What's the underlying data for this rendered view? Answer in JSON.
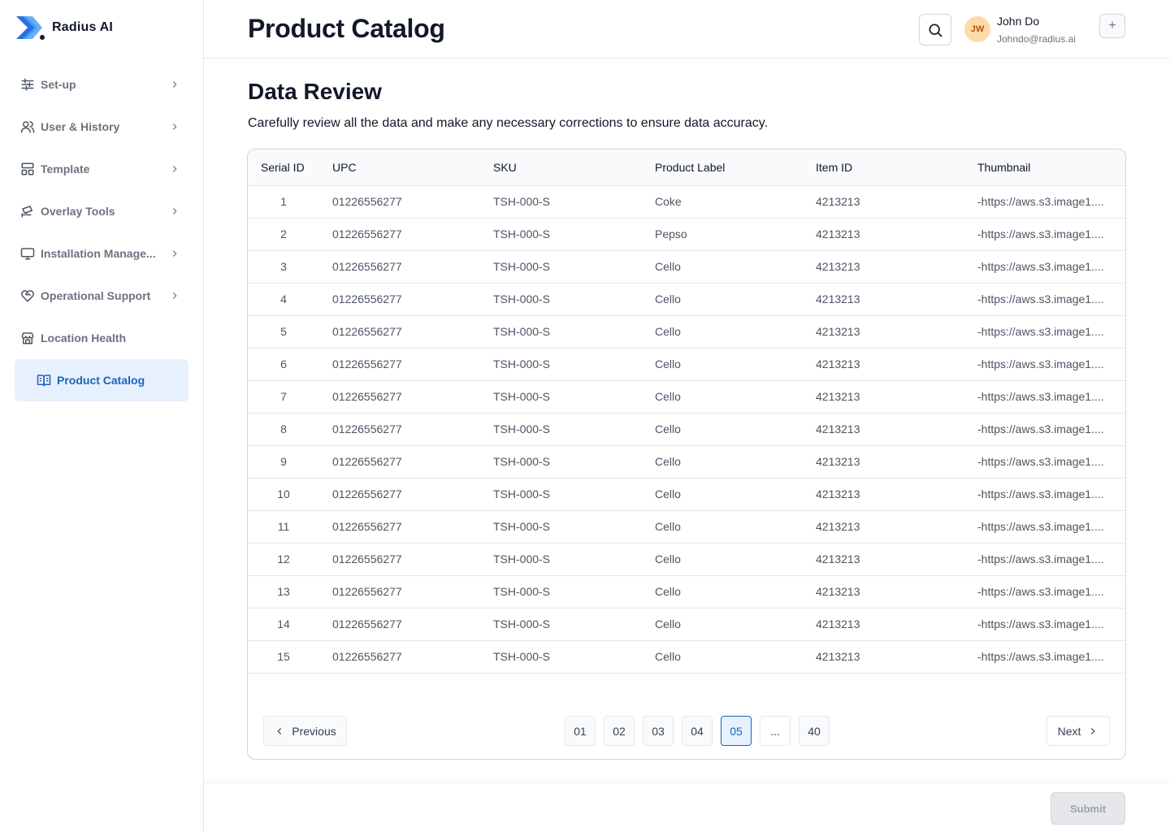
{
  "brand": {
    "name": "Radius AI",
    "logo_icon": "radius-logo"
  },
  "sidebar": {
    "items": [
      {
        "label": "Set-up",
        "icon": "sliders-icon",
        "has_chevron": true
      },
      {
        "label": "User & History",
        "icon": "users-icon",
        "has_chevron": true
      },
      {
        "label": "Template",
        "icon": "layout-icon",
        "has_chevron": true
      },
      {
        "label": "Overlay Tools",
        "icon": "cctv-icon",
        "has_chevron": true
      },
      {
        "label": "Installation Manage...",
        "icon": "monitor-icon",
        "has_chevron": true
      },
      {
        "label": "Operational Support",
        "icon": "heart-handshake-icon",
        "has_chevron": true
      },
      {
        "label": "Location Health",
        "icon": "store-icon",
        "has_chevron": false
      },
      {
        "label": "Product Catalog",
        "icon": "book-open-icon",
        "has_chevron": false,
        "active": true
      }
    ]
  },
  "header": {
    "title": "Product Catalog",
    "user": {
      "initials": "JW",
      "name": "John Do",
      "email": "Johndo@radius.ai"
    },
    "plus_label": "+"
  },
  "section": {
    "title": "Data Review",
    "description": "Carefully review all the data and make any necessary corrections to ensure data accuracy."
  },
  "table": {
    "columns": [
      "Serial ID",
      "UPC",
      "SKU",
      "Product Label",
      "Item ID",
      "Thumbnail"
    ],
    "rows": [
      [
        "1",
        "01226556277",
        "TSH-000-S",
        "Coke",
        "4213213",
        "-https://aws.s3.image1...."
      ],
      [
        "2",
        "01226556277",
        "TSH-000-S",
        "Pepso",
        "4213213",
        "-https://aws.s3.image1...."
      ],
      [
        "3",
        "01226556277",
        "TSH-000-S",
        "Cello",
        "4213213",
        "-https://aws.s3.image1...."
      ],
      [
        "4",
        "01226556277",
        "TSH-000-S",
        "Cello",
        "4213213",
        "-https://aws.s3.image1...."
      ],
      [
        "5",
        "01226556277",
        "TSH-000-S",
        "Cello",
        "4213213",
        "-https://aws.s3.image1...."
      ],
      [
        "6",
        "01226556277",
        "TSH-000-S",
        "Cello",
        "4213213",
        "-https://aws.s3.image1...."
      ],
      [
        "7",
        "01226556277",
        "TSH-000-S",
        "Cello",
        "4213213",
        "-https://aws.s3.image1...."
      ],
      [
        "8",
        "01226556277",
        "TSH-000-S",
        "Cello",
        "4213213",
        "-https://aws.s3.image1...."
      ],
      [
        "9",
        "01226556277",
        "TSH-000-S",
        "Cello",
        "4213213",
        "-https://aws.s3.image1...."
      ],
      [
        "10",
        "01226556277",
        "TSH-000-S",
        "Cello",
        "4213213",
        "-https://aws.s3.image1...."
      ],
      [
        "11",
        "01226556277",
        "TSH-000-S",
        "Cello",
        "4213213",
        "-https://aws.s3.image1...."
      ],
      [
        "12",
        "01226556277",
        "TSH-000-S",
        "Cello",
        "4213213",
        "-https://aws.s3.image1...."
      ],
      [
        "13",
        "01226556277",
        "TSH-000-S",
        "Cello",
        "4213213",
        "-https://aws.s3.image1...."
      ],
      [
        "14",
        "01226556277",
        "TSH-000-S",
        "Cello",
        "4213213",
        "-https://aws.s3.image1...."
      ],
      [
        "15",
        "01226556277",
        "TSH-000-S",
        "Cello",
        "4213213",
        "-https://aws.s3.image1...."
      ]
    ]
  },
  "pagination": {
    "previous_label": "Previous",
    "next_label": "Next",
    "pages": [
      "01",
      "02",
      "03",
      "04",
      "05",
      "...",
      "40"
    ],
    "current": "05"
  },
  "footer": {
    "submit_label": "Submit"
  },
  "colors": {
    "accent": "#1d63b7",
    "accent_bg": "#e7f1fd",
    "avatar_bg": "#fddba8"
  }
}
